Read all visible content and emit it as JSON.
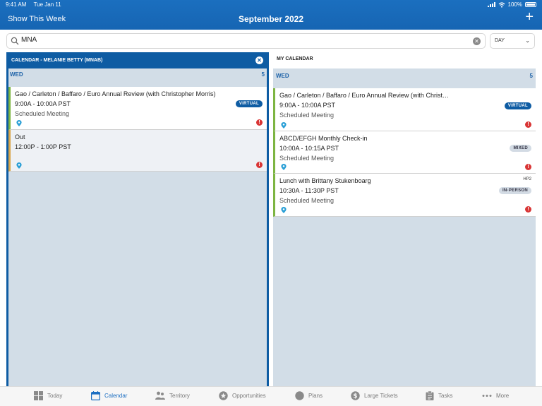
{
  "status": {
    "time": "9:41 AM",
    "date": "Tue Jan 11",
    "battery": "100%"
  },
  "header": {
    "left_link": "Show This Week",
    "title": "September 2022"
  },
  "search": {
    "value": "MNA",
    "view": "DAY"
  },
  "left_calendar": {
    "title": "CALENDAR - MELANIE BETTY (MNAB)",
    "day": "WED",
    "date": "5",
    "events": [
      {
        "title": "Gao / Carleton / Baffaro / Euro Annual Review (with Christopher Morris)",
        "time": "9:00A - 10:00A PST",
        "type": "Scheduled Meeting",
        "badge": "VIRTUAL"
      },
      {
        "title": "Out",
        "time": "12:00P - 1:00P PST",
        "type": "",
        "badge": ""
      }
    ]
  },
  "right_calendar": {
    "title": "MY CALENDAR",
    "day": "WED",
    "date": "5",
    "events": [
      {
        "title": "Gao / Carleton / Baffaro / Euro Annual Review (with Christ…",
        "time": "9:00A - 10:00A PST",
        "type": "Scheduled Meeting",
        "badge": "VIRTUAL",
        "tag": ""
      },
      {
        "title": "ABCD/EFGH Monthly Check-in",
        "time": "10:00A - 10:15A PST",
        "type": "Scheduled Meeting",
        "badge": "MIXED",
        "tag": ""
      },
      {
        "title": "Lunch with Brittany Stukenboarg",
        "time": "10:30A - 11:30P PST",
        "type": "Scheduled Meeting",
        "badge": "IN-PERSON",
        "tag": "HP2"
      }
    ]
  },
  "tabs": [
    {
      "label": "Today",
      "icon": "grid-icon"
    },
    {
      "label": "Calendar",
      "icon": "calendar-icon"
    },
    {
      "label": "Territory",
      "icon": "people-icon"
    },
    {
      "label": "Opportunities",
      "icon": "star-icon"
    },
    {
      "label": "Plans",
      "icon": "circle-icon"
    },
    {
      "label": "Large Tickets",
      "icon": "dollar-icon"
    },
    {
      "label": "Tasks",
      "icon": "clipboard-icon"
    },
    {
      "label": "More",
      "icon": "ellipsis-icon"
    }
  ],
  "colors": {
    "header": "#1665b3",
    "accent": "#0e5ca3",
    "column_bg": "#d2dde7",
    "alert": "#d93636",
    "pin": "#2a9fd6",
    "bar_green": "#7db542",
    "bar_orange": "#d9a64a"
  }
}
